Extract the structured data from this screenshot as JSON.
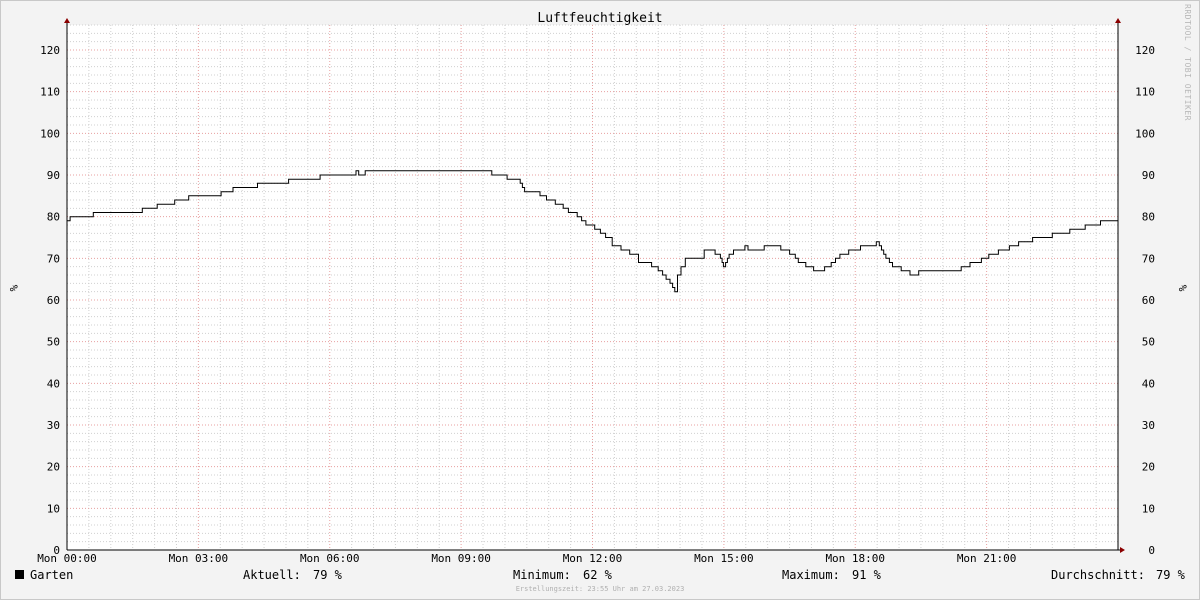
{
  "watermark": "RRDTOOL / TOBI OETIKER",
  "legend": {
    "series_name": "Garten",
    "current_label": "Aktuell:",
    "current_value": "79 %",
    "min_label": "Minimum:",
    "min_value": "62 %",
    "max_label": "Maximum:",
    "max_value": "91 %",
    "avg_label": "Durchschnitt:",
    "avg_value": "79 %"
  },
  "footer": "Erstellungszeit: 23:55 Uhr am 27.03.2023",
  "colors": {
    "background": "#f3f3f3",
    "plot_background": "#ffffff",
    "major_grid": "#e8a0a0",
    "minor_grid": "#d0d0d0",
    "series": "#000000",
    "axis_arrow": "#8b0000"
  },
  "chart_data": {
    "type": "line",
    "title": "Luftfeuchtigkeit",
    "ylabel": "%",
    "ylabel_right": "%",
    "xlabel": "",
    "xlim": [
      0,
      24
    ],
    "ylim": [
      0,
      126
    ],
    "y_ticks": [
      0,
      10,
      20,
      30,
      40,
      50,
      60,
      70,
      80,
      90,
      100,
      110,
      120
    ],
    "x_ticks": [
      {
        "value": 0,
        "label": "Mon 00:00"
      },
      {
        "value": 3,
        "label": "Mon 03:00"
      },
      {
        "value": 6,
        "label": "Mon 06:00"
      },
      {
        "value": 9,
        "label": "Mon 09:00"
      },
      {
        "value": 12,
        "label": "Mon 12:00"
      },
      {
        "value": 15,
        "label": "Mon 15:00"
      },
      {
        "value": 18,
        "label": "Mon 18:00"
      },
      {
        "value": 21,
        "label": "Mon 21:00"
      }
    ],
    "grid": true,
    "legend_position": "bottom",
    "series": [
      {
        "name": "Garten",
        "color": "#000000",
        "step": true,
        "x": [
          0,
          0.07,
          0.6,
          1.72,
          2.06,
          2.46,
          2.78,
          3.52,
          3.79,
          4.35,
          5.06,
          5.78,
          6.6,
          6.66,
          6.73,
          6.81,
          9.7,
          10.05,
          10.35,
          10.4,
          10.45,
          10.57,
          10.8,
          10.95,
          11.15,
          11.33,
          11.45,
          11.65,
          11.75,
          11.85,
          11.95,
          12.05,
          12.18,
          12.3,
          12.45,
          12.65,
          12.85,
          13.05,
          13.25,
          13.35,
          13.5,
          13.6,
          13.63,
          13.68,
          13.72,
          13.77,
          13.83,
          13.88,
          13.94,
          14.02,
          14.12,
          14.55,
          14.8,
          14.92,
          14.96,
          14.99,
          15.04,
          15.08,
          15.12,
          15.22,
          15.43,
          15.48,
          15.55,
          15.86,
          15.92,
          16.3,
          16.5,
          16.63,
          16.7,
          16.78,
          16.87,
          17.05,
          17.3,
          17.37,
          17.45,
          17.55,
          17.65,
          17.85,
          17.9,
          18.12,
          18.48,
          18.55,
          18.6,
          18.65,
          18.7,
          18.78,
          18.85,
          19.05,
          19.25,
          19.45,
          19.9,
          20.42,
          20.62,
          20.88,
          21.05,
          21.27,
          21.52,
          21.73,
          21.88,
          22.05,
          22.5,
          22.9,
          23.25,
          23.6,
          24
        ],
        "y": [
          79,
          80,
          81,
          82,
          83,
          84,
          85,
          86,
          87,
          88,
          89,
          90,
          91,
          90,
          90,
          91,
          90,
          89,
          88,
          87,
          86,
          86,
          85,
          84,
          83,
          82,
          81,
          80,
          79,
          78,
          78,
          77,
          76,
          75,
          73,
          72,
          71,
          69,
          69,
          68,
          67,
          66,
          66,
          65,
          65,
          64,
          63,
          62,
          66,
          68,
          70,
          72,
          71,
          70,
          69,
          68,
          69,
          70,
          71,
          72,
          72,
          73,
          72,
          72,
          73,
          72,
          71,
          70,
          69,
          69,
          68,
          67,
          68,
          68,
          69,
          70,
          71,
          72,
          72,
          73,
          74,
          73,
          72,
          71,
          70,
          69,
          68,
          67,
          66,
          67,
          67,
          68,
          69,
          70,
          71,
          72,
          73,
          74,
          74,
          75,
          76,
          77,
          78,
          79,
          79
        ]
      }
    ]
  }
}
